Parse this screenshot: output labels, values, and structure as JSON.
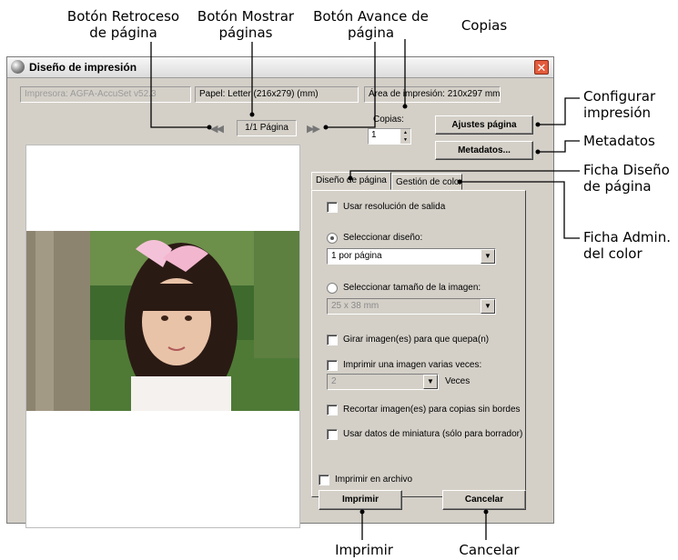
{
  "callouts": {
    "back_button": "Botón Retroceso\nde página",
    "show_pages": "Botón Mostrar\npáginas",
    "forward_button": "Botón Avance de\npágina",
    "copies": "Copias",
    "config_print": "Configurar\nimpresión",
    "metadata": "Metadatos",
    "layout_tab": "Ficha Diseño\nde página",
    "color_tab": "Ficha Admin.\ndel color",
    "print": "Imprimir",
    "cancel": "Cancelar"
  },
  "window": {
    "title": "Diseño de impresión",
    "printer": "Impresora: AGFA-AccuSet v52.3",
    "paper": "Papel: Letter (216x279) (mm)",
    "print_area": "Área de impresión:  210x297 mm",
    "page_indicator": "1/1 Página",
    "copies_label": "Copias:",
    "copies_value": "1",
    "page_setup_button": "Ajustes página",
    "metadata_button": "Metadatos...",
    "tabs": [
      "Diseño de página",
      "Gestión de color"
    ],
    "layout": {
      "use_output_resolution": "Usar resolución de salida",
      "select_layout": "Seleccionar diseño:",
      "layout_value": "1 por página",
      "select_image_size": "Seleccionar tamaño de la imagen:",
      "image_size_value": "25 x 38 mm",
      "rotate": "Girar imagen(es) para que quepa(n)",
      "print_multiple": "Imprimir una imagen varias veces:",
      "times_value": "2",
      "times_label": "Veces",
      "crop": "Recortar imagen(es) para copias sin bordes",
      "thumbnail": "Usar datos de miniatura (sólo para borrador)"
    },
    "print_to_file": "Imprimir en archivo",
    "print_button": "Imprimir",
    "cancel_button": "Cancelar"
  },
  "colors": {
    "close_red": "#e25b3c",
    "dialog_gray": "#d4d0c8"
  }
}
